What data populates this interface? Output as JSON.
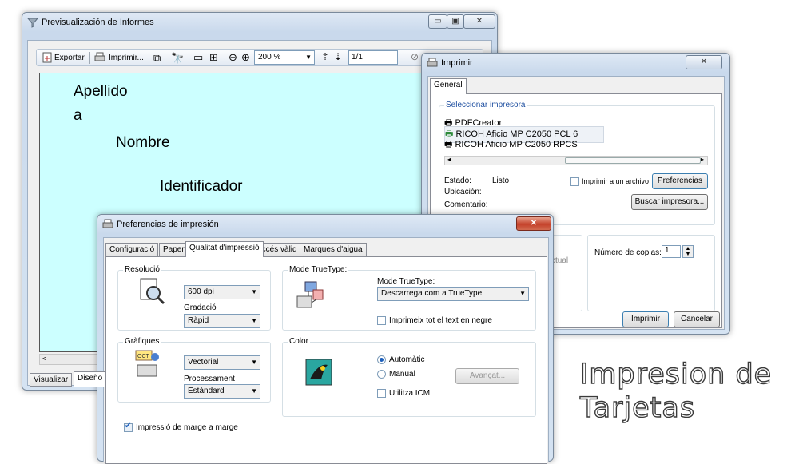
{
  "preview": {
    "title": "Previsualización de Informes",
    "toolbar": {
      "export_label": "Exportar",
      "print_label": "Imprimir...",
      "zoom_value": "200 %",
      "page_value": "1/1",
      "trailing_label": "Ar"
    },
    "canvas_lines": [
      "Apellido",
      "a",
      "Nombre",
      "Identificador"
    ],
    "bottom_tabs": [
      "Visualizar",
      "Diseño"
    ],
    "canvas_color": "#ccffff"
  },
  "print_dialog": {
    "title": "Imprimir",
    "tab_general": "General",
    "printer_group_label": "Seleccionar impresora",
    "printers": [
      "PDFCreator",
      "RICOH Aficio MP C2050 PCL 6",
      "RICOH Aficio MP C2050 RPCS"
    ],
    "status_label": "Estado:",
    "status_value": "Listo",
    "location_label": "Ubicación:",
    "comment_label": "Comentario:",
    "print_to_file_label": "Imprimir a un archivo",
    "preferences_button": "Preferencias",
    "find_printer_button": "Buscar impresora...",
    "partial_label": "ctual",
    "copies_label": "Número de copias:",
    "copies_value": "1",
    "print_button": "Imprimir",
    "cancel_button": "Cancelar"
  },
  "prefs_dialog": {
    "title": "Preferencias de impresión",
    "tabs": [
      "Configuració",
      "Paper",
      "Qualitat d'impressió",
      "Accés vàlid",
      "Marques d'aigua"
    ],
    "resolution_group": "Resolució",
    "resolution_value": "600 dpi",
    "gradation_label": "Gradació",
    "gradation_value": "Ràpid",
    "truetype_group": "Mode TrueType:",
    "truetype_label": "Mode TrueType:",
    "truetype_value": "Descarrega com a TrueType",
    "print_black_label": "Imprimeix tot el text en negre",
    "graphics_group": "Gràfiques",
    "graphics_value": "Vectorial",
    "processing_label": "Processament",
    "processing_value": "Estàndard",
    "color_group": "Color",
    "auto_label": "Automàtic",
    "manual_label": "Manual",
    "advanced_button": "Avançat...",
    "icm_label": "Utilitza ICM",
    "margin_label": "Impressió de marge a marge"
  },
  "caption": {
    "line1": "Impresion de",
    "line2": "Tarjetas"
  }
}
